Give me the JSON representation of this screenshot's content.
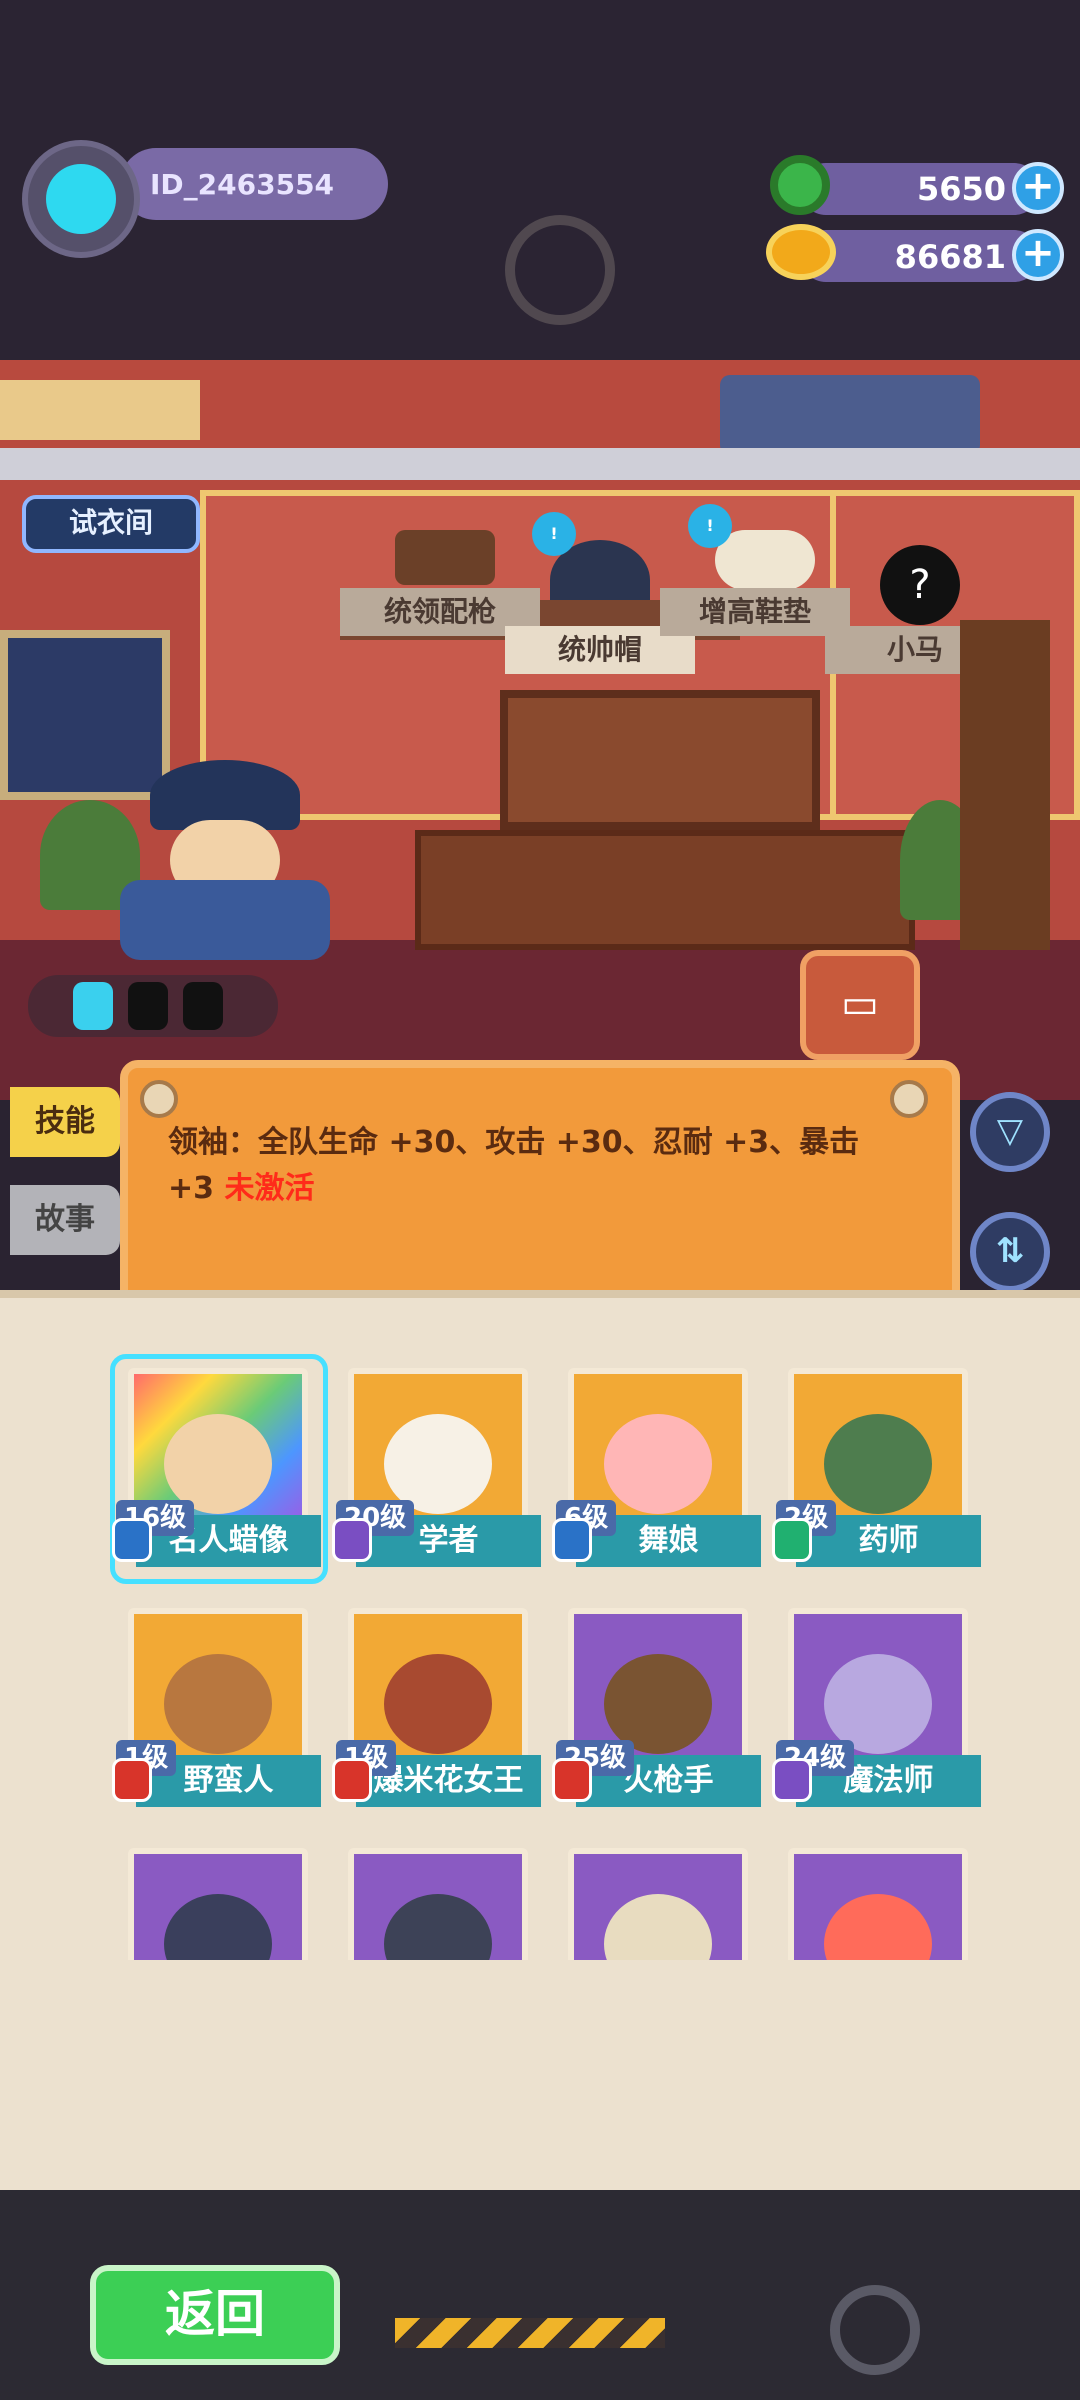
{
  "profile": {
    "id_label": "ID_2463554"
  },
  "currency": [
    {
      "name": "donut",
      "value": "5650"
    },
    {
      "name": "coin",
      "value": "86681"
    }
  ],
  "room": {
    "try_button": "试衣间",
    "shelf_items": [
      "统领配枪",
      "统帅帽",
      "增高鞋垫",
      "小马"
    ]
  },
  "tabs": {
    "skill": "技能",
    "story": "故事"
  },
  "skill_text": {
    "main": "领袖：全队生命 +30、攻击 +30、忍耐 +3、暴击 +3 ",
    "status": "未激活"
  },
  "characters": [
    {
      "name": "名人蜡像",
      "level": "16级",
      "rarity": "rainbow",
      "badge": "#2a72c7",
      "face": "#f2d2a8"
    },
    {
      "name": "学者",
      "level": "20级",
      "rarity": "gold",
      "badge": "#7a4ec2",
      "face": "#f7f1e6"
    },
    {
      "name": "舞娘",
      "level": "6级",
      "rarity": "gold",
      "badge": "#2a72c7",
      "face": "#ffb6b6"
    },
    {
      "name": "药师",
      "level": "2级",
      "rarity": "gold",
      "badge": "#20b070",
      "face": "#4e7d4e"
    },
    {
      "name": "野蛮人",
      "level": "1级",
      "rarity": "gold",
      "badge": "#d8342a",
      "face": "#b8773f"
    },
    {
      "name": "爆米花女王",
      "level": "1级",
      "rarity": "gold",
      "badge": "#d8342a",
      "face": "#a84a30"
    },
    {
      "name": "火枪手",
      "level": "25级",
      "rarity": "purple",
      "badge": "#d8342a",
      "face": "#7a5432"
    },
    {
      "name": "魔法师",
      "level": "24级",
      "rarity": "purple",
      "badge": "#7a4ec2",
      "face": "#b8a8e0"
    },
    {
      "name": "",
      "level": "",
      "rarity": "purple",
      "badge": "",
      "face": "#3a3f5c"
    },
    {
      "name": "",
      "level": "",
      "rarity": "purple",
      "badge": "",
      "face": "#3d4257"
    },
    {
      "name": "",
      "level": "",
      "rarity": "purple",
      "badge": "",
      "face": "#e8dcc0"
    },
    {
      "name": "",
      "level": "",
      "rarity": "purple",
      "badge": "",
      "face": "#ff6b5a"
    }
  ],
  "footer": {
    "back_label": "返回"
  }
}
